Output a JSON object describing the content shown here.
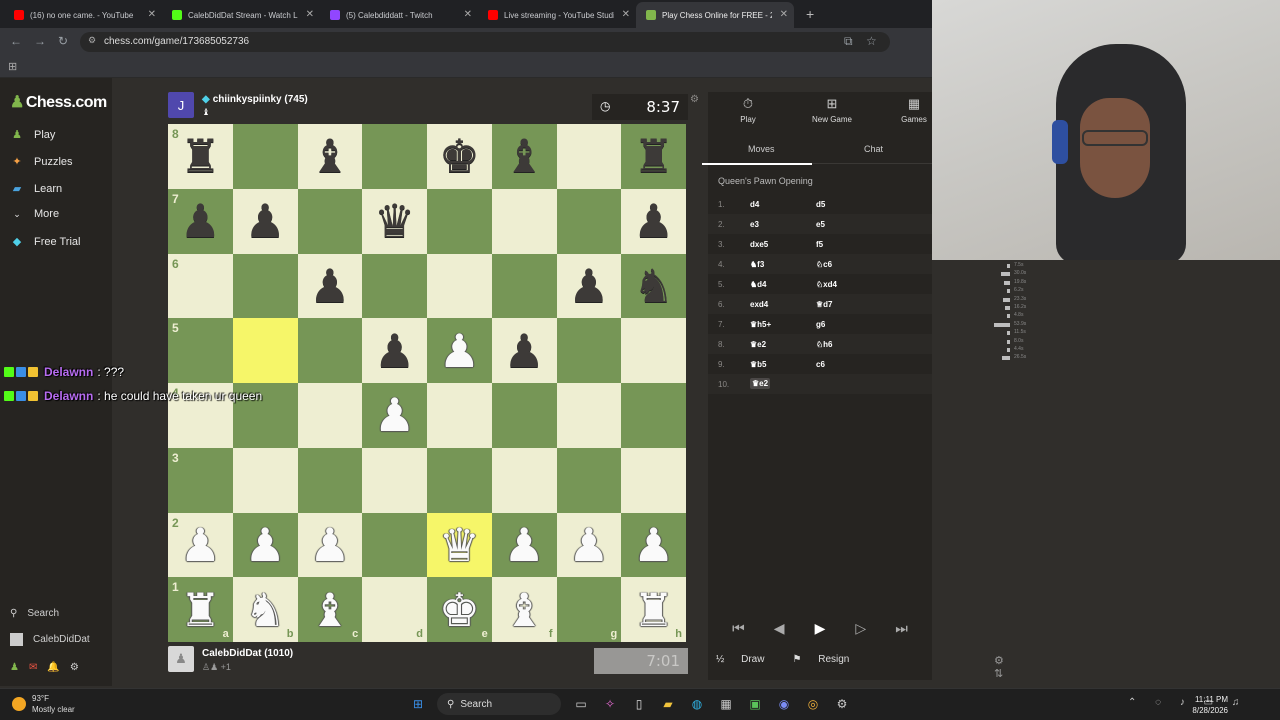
{
  "browser": {
    "tabs": [
      {
        "title": "(16) no one came. - YouTube",
        "color": "#ff0000"
      },
      {
        "title": "CalebDidDat Stream - Watch Li",
        "color": "#53fc18"
      },
      {
        "title": "(5) Calebdiddatt - Twitch",
        "color": "#9146ff"
      },
      {
        "title": "Live streaming - YouTube Studi",
        "color": "#ff0000"
      },
      {
        "title": "Play Chess Online for FREE - 2 P",
        "color": "#81b64c"
      }
    ],
    "new_tab": "+",
    "url": "chess.com/game/173685052736"
  },
  "sidebar": {
    "logo": "Chess.com",
    "items": [
      {
        "label": "Play",
        "icon": "play-icon"
      },
      {
        "label": "Puzzles",
        "icon": "puzzle-icon"
      },
      {
        "label": "Learn",
        "icon": "learn-icon"
      },
      {
        "label": "More",
        "icon": "chevron-down-icon"
      },
      {
        "label": "Free Trial",
        "icon": "diamond-icon"
      }
    ],
    "search": "Search",
    "user": "CalebDidDat"
  },
  "opponent": {
    "initial": "J",
    "name": "chiinkyspiinky (745)",
    "clock": "8:37"
  },
  "player": {
    "name": "CalebDidDat (1010)",
    "clock": "7:01",
    "captured": "+1"
  },
  "board": {
    "ranks": [
      "8",
      "7",
      "6",
      "5",
      "4",
      "3",
      "2",
      "1"
    ],
    "files": [
      "a",
      "b",
      "c",
      "d",
      "e",
      "f",
      "g",
      "h"
    ],
    "position": [
      [
        "r",
        "",
        "b",
        "",
        "k",
        "b",
        "",
        "r"
      ],
      [
        "p",
        "p",
        "",
        "q",
        "",
        "",
        "",
        "p"
      ],
      [
        "",
        "",
        "p",
        "",
        "",
        "",
        "p",
        "n"
      ],
      [
        "",
        "",
        "",
        "p",
        "P",
        "p",
        "",
        ""
      ],
      [
        "",
        "",
        "",
        "P",
        "",
        "",
        "",
        ""
      ],
      [
        "",
        "",
        "",
        "",
        "",
        "",
        "",
        ""
      ],
      [
        "P",
        "P",
        "P",
        "",
        "Q",
        "P",
        "P",
        "P"
      ],
      [
        "R",
        "N",
        "B",
        "",
        "K",
        "B",
        "",
        "R"
      ]
    ],
    "highlight": [
      "b5",
      "e2"
    ]
  },
  "chat": [
    {
      "user": "Delawnn",
      "sep": ":",
      "text": "???"
    },
    {
      "user": "Delawnn",
      "sep": ":",
      "text": "he could have taken ur queen"
    }
  ],
  "panel": {
    "tabs": [
      {
        "label": "Play",
        "icon": "stopwatch-icon"
      },
      {
        "label": "New Game",
        "icon": "plus-icon"
      },
      {
        "label": "Games",
        "icon": "board-icon"
      }
    ],
    "subtabs": [
      "Moves",
      "Chat"
    ],
    "opening": "Queen's Pawn Opening",
    "moves": [
      {
        "n": "1.",
        "w": "d4",
        "b": "d5"
      },
      {
        "n": "2.",
        "w": "e3",
        "b": "e5"
      },
      {
        "n": "3.",
        "w": "dxe5",
        "b": "f5"
      },
      {
        "n": "4.",
        "w": "♞f3",
        "b": "♘c6"
      },
      {
        "n": "5.",
        "w": "♞d4",
        "b": "♘xd4"
      },
      {
        "n": "6.",
        "w": "exd4",
        "b": "♕d7"
      },
      {
        "n": "7.",
        "w": "♛h5+",
        "b": "g6"
      },
      {
        "n": "8.",
        "w": "♛e2",
        "b": "♘h6"
      },
      {
        "n": "9.",
        "w": "♛b5",
        "b": "c6"
      },
      {
        "n": "10.",
        "w": "♛e2",
        "b": ""
      }
    ],
    "draw": "Draw",
    "resign": "Resign"
  },
  "move_times": [
    "7.5s",
    "30.0s",
    "19.8s",
    "6.2s",
    "23.3s",
    "16.2s",
    "4.8s",
    "53.9s",
    "11.5s",
    "8.0s",
    "4.4s",
    "26.5s"
  ],
  "taskbar": {
    "temp": "93°F",
    "weather": "Mostly clear",
    "search": "Search",
    "time": "11:11 PM",
    "date": "8/28/2026"
  }
}
